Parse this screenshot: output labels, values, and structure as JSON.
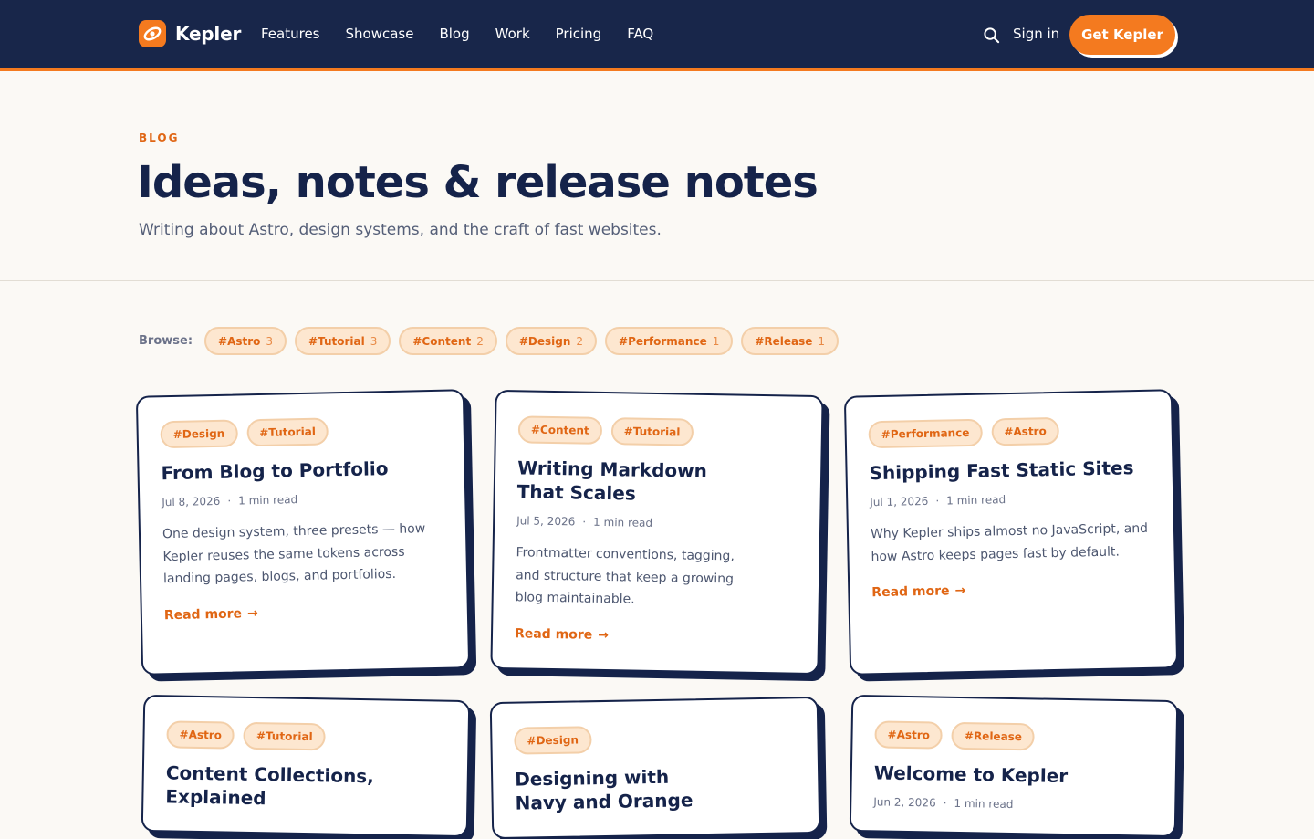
{
  "nav": {
    "brand": "Kepler",
    "links": [
      "Features",
      "Showcase",
      "Blog",
      "Work",
      "Pricing",
      "FAQ"
    ],
    "signin": "Sign in",
    "cta": "Get Kepler"
  },
  "hero": {
    "eyebrow": "BLOG",
    "title": "Ideas, notes & release notes",
    "subtitle": "Writing about Astro, design systems, and the craft of fast websites."
  },
  "browse": {
    "label": "Browse:",
    "tags": [
      {
        "name": "#Astro",
        "count": "3"
      },
      {
        "name": "#Tutorial",
        "count": "3"
      },
      {
        "name": "#Content",
        "count": "2"
      },
      {
        "name": "#Design",
        "count": "2"
      },
      {
        "name": "#Performance",
        "count": "1"
      },
      {
        "name": "#Release",
        "count": "1"
      }
    ]
  },
  "posts": [
    {
      "tags": [
        "#Design",
        "#Tutorial"
      ],
      "title": "From Blog to Portfolio",
      "date": "Jul 8, 2026",
      "read": "1 min read",
      "desc": "One design system, three presets — how Kepler reuses the same tokens across landing pages, blogs, and portfolios.",
      "more": "Read more"
    },
    {
      "tags": [
        "#Content",
        "#Tutorial"
      ],
      "title": "Writing Markdown That Scales",
      "date": "Jul 5, 2026",
      "read": "1 min read",
      "desc": "Frontmatter conventions, tagging, and structure that keep a growing blog maintainable.",
      "more": "Read more"
    },
    {
      "tags": [
        "#Performance",
        "#Astro"
      ],
      "title": "Shipping Fast Static Sites",
      "date": "Jul 1, 2026",
      "read": "1 min read",
      "desc": "Why Kepler ships almost no JavaScript, and how Astro keeps pages fast by default.",
      "more": "Read more"
    },
    {
      "tags": [
        "#Astro",
        "#Tutorial"
      ],
      "title": "Content Collections, Explained",
      "date": "",
      "read": "",
      "desc": "",
      "more": ""
    },
    {
      "tags": [
        "#Design"
      ],
      "title": "Designing with Navy and Orange",
      "date": "",
      "read": "",
      "desc": "",
      "more": ""
    },
    {
      "tags": [
        "#Astro",
        "#Release"
      ],
      "title": "Welcome to Kepler",
      "date": "Jun 2, 2026",
      "read": "1 min read",
      "desc": "",
      "more": ""
    }
  ]
}
